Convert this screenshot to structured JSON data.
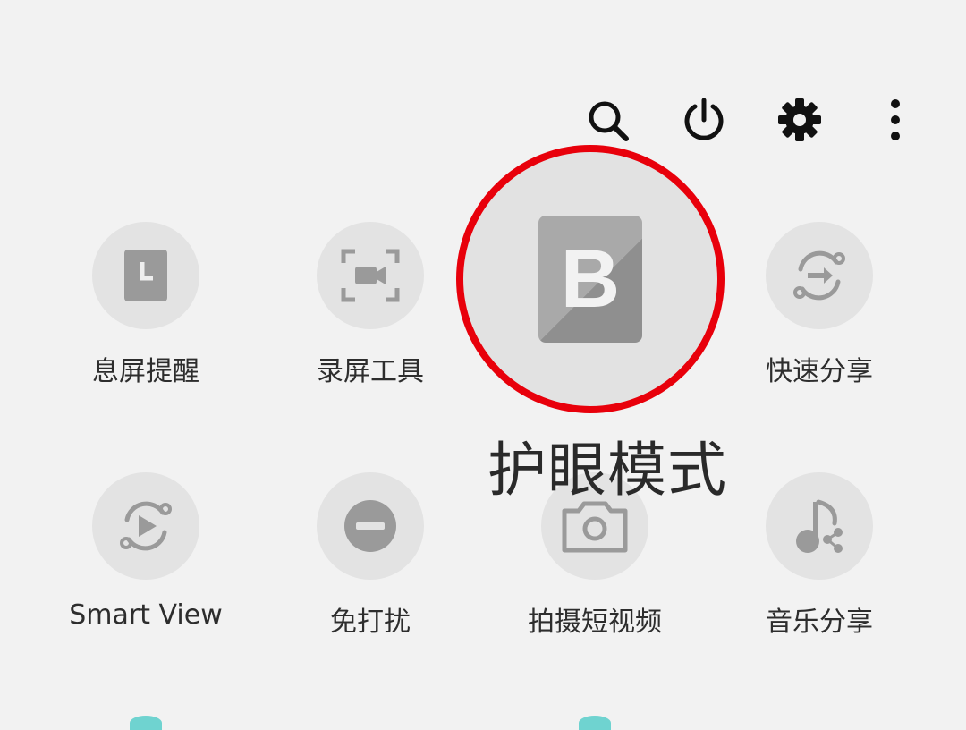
{
  "header": {
    "icons": [
      "search-icon",
      "power-icon",
      "gear-icon",
      "more-vert-icon"
    ]
  },
  "tiles": [
    {
      "label": "息屏提醒",
      "icon": "aod-clock-icon"
    },
    {
      "label": "录屏工具",
      "icon": "screen-recorder-icon"
    },
    {
      "label": "快速分享",
      "icon": "quick-share-icon"
    },
    {
      "label": "Smart View",
      "icon": "smart-view-icon"
    },
    {
      "label": "免打扰",
      "icon": "do-not-disturb-icon"
    },
    {
      "label": "拍摄短视频",
      "icon": "camera-icon"
    },
    {
      "label": "音乐分享",
      "icon": "music-share-icon"
    }
  ],
  "zoom": {
    "label": "护眼模式",
    "glyph": "B",
    "icon": "eye-comfort-icon"
  },
  "colors": {
    "background": "#f2f2f2",
    "tile_circle": "#e3e3e3",
    "icon_gray": "#9a9a9a",
    "highlight_ring": "#e8000b",
    "teal_peek": "#6fd3d0"
  }
}
